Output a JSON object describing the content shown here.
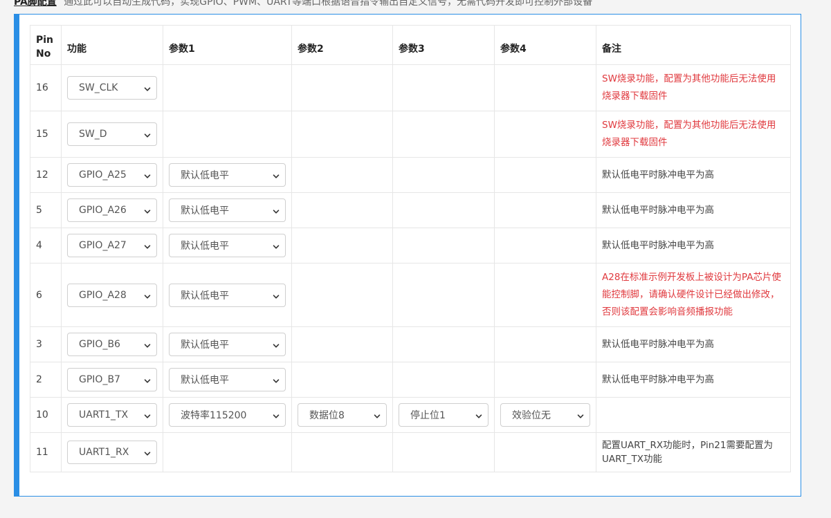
{
  "page": {
    "section_heading": "PA脚配置",
    "section_desc": "通过此可以自动生成代码，实现GPIO、PWM、UART等端口根据语音指令输出自定义信号，无需代码开发即可控制外部设备"
  },
  "table": {
    "headers": {
      "pin_no": "Pin No",
      "function": "功能",
      "param1": "参数1",
      "param2": "参数2",
      "param3": "参数3",
      "param4": "参数4",
      "remark": "备注"
    },
    "rows": [
      {
        "pin": "16",
        "function": "SW_CLK",
        "param1": "",
        "param2": "",
        "param3": "",
        "param4": "",
        "remark": "SW烧录功能，配置为其他功能后无法使用烧录器下载固件",
        "remark_color": "#e0393e"
      },
      {
        "pin": "15",
        "function": "SW_D",
        "param1": "",
        "param2": "",
        "param3": "",
        "param4": "",
        "remark": "SW烧录功能，配置为其他功能后无法使用烧录器下载固件",
        "remark_color": "#e0393e"
      },
      {
        "pin": "12",
        "function": "GPIO_A25",
        "param1": "默认低电平",
        "param2": "",
        "param3": "",
        "param4": "",
        "remark": "默认低电平时脉冲电平为高",
        "remark_color": "#444444"
      },
      {
        "pin": "5",
        "function": "GPIO_A26",
        "param1": "默认低电平",
        "param2": "",
        "param3": "",
        "param4": "",
        "remark": "默认低电平时脉冲电平为高",
        "remark_color": "#444444"
      },
      {
        "pin": "4",
        "function": "GPIO_A27",
        "param1": "默认低电平",
        "param2": "",
        "param3": "",
        "param4": "",
        "remark": "默认低电平时脉冲电平为高",
        "remark_color": "#444444"
      },
      {
        "pin": "6",
        "function": "GPIO_A28",
        "param1": "默认低电平",
        "param2": "",
        "param3": "",
        "param4": "",
        "remark": "A28在标准示例开发板上被设计为PA芯片使能控制脚，请确认硬件设计已经做出修改，否则该配置会影响音频播报功能",
        "remark_color": "#e0393e"
      },
      {
        "pin": "3",
        "function": "GPIO_B6",
        "param1": "默认低电平",
        "param2": "",
        "param3": "",
        "param4": "",
        "remark": "默认低电平时脉冲电平为高",
        "remark_color": "#444444"
      },
      {
        "pin": "2",
        "function": "GPIO_B7",
        "param1": "默认低电平",
        "param2": "",
        "param3": "",
        "param4": "",
        "remark": "默认低电平时脉冲电平为高",
        "remark_color": "#444444"
      },
      {
        "pin": "10",
        "function": "UART1_TX",
        "param1": "波特率115200",
        "param2": "数据位8",
        "param3": "停止位1",
        "param4": "效验位无",
        "remark": "",
        "remark_color": "#444444"
      },
      {
        "pin": "11",
        "function": "UART1_RX",
        "param1": "",
        "param2": "",
        "param3": "",
        "param4": "",
        "remark": "配置UART_RX功能时，Pin21需要配置为UART_TX功能",
        "remark_color": "#444444"
      }
    ]
  },
  "colors": {
    "accent": "#2a8ee5",
    "warning_text": "#e0393e"
  },
  "icons": {
    "select_arrow": "chevron-down-icon"
  }
}
